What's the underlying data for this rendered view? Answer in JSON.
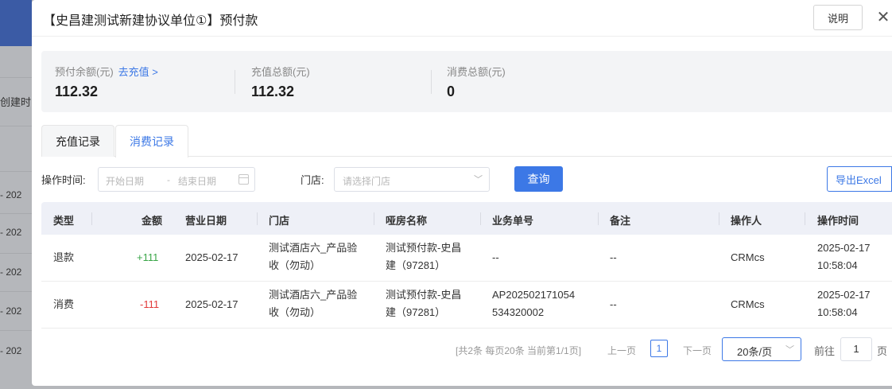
{
  "background": {
    "label": "创建时",
    "rows": [
      "- 202",
      "- 202",
      "- 202",
      "- 202",
      "- 202"
    ]
  },
  "dialog": {
    "title": "【史昌建测试新建协议单位①】预付款",
    "help_label": "说明",
    "close_label": "✕"
  },
  "summary": {
    "balance_label": "预付余额(元)",
    "recharge_link": "去充值 >",
    "balance_value": "112.32",
    "recharge_total_label": "充值总额(元)",
    "recharge_total_value": "112.32",
    "consume_total_label": "消费总额(元)",
    "consume_total_value": "0"
  },
  "tabs": [
    {
      "label": "充值记录",
      "active": false
    },
    {
      "label": "消费记录",
      "active": true
    }
  ],
  "filters": {
    "time_label": "操作时间:",
    "start_placeholder": "开始日期",
    "range_sep": "-",
    "end_placeholder": "结束日期",
    "store_label": "门店:",
    "store_placeholder": "请选择门店",
    "query_label": "查询",
    "export_label": "导出Excel"
  },
  "table": {
    "columns": [
      "类型",
      "金额",
      "营业日期",
      "门店",
      "哑房名称",
      "业务单号",
      "备注",
      "操作人",
      "操作时间"
    ],
    "rows": [
      {
        "type": "退款",
        "amount": "+111",
        "date": "2025-02-17",
        "store_line1": "测试酒店六_产品验",
        "store_line2": "收（勿动）",
        "room_line1": "测试预付款-史昌",
        "room_line2": "建（97281）",
        "order_line1": "--",
        "order_line2": "",
        "remark": "--",
        "operator": "CRMcs",
        "time_line1": "2025-02-17",
        "time_line2": "10:58:04"
      },
      {
        "type": "消费",
        "amount": "-111",
        "date": "2025-02-17",
        "store_line1": "测试酒店六_产品验",
        "store_line2": "收（勿动）",
        "room_line1": "测试预付款-史昌",
        "room_line2": "建（97281）",
        "order_line1": "AP202502171054",
        "order_line2": "534320002",
        "remark": "--",
        "operator": "CRMcs",
        "time_line1": "2025-02-17",
        "time_line2": "10:58:04"
      }
    ]
  },
  "pagination": {
    "summary": "[共2条 每页20条 当前第1/1页]",
    "prev_label": "上一页",
    "current_page": "1",
    "next_label": "下一页",
    "page_size": "20条/页",
    "goto_label": "前往",
    "goto_value": "1",
    "goto_unit": "页"
  },
  "colors": {
    "accent": "#3c78e6",
    "positive": "#3aa648",
    "negative": "#e33b3b"
  }
}
